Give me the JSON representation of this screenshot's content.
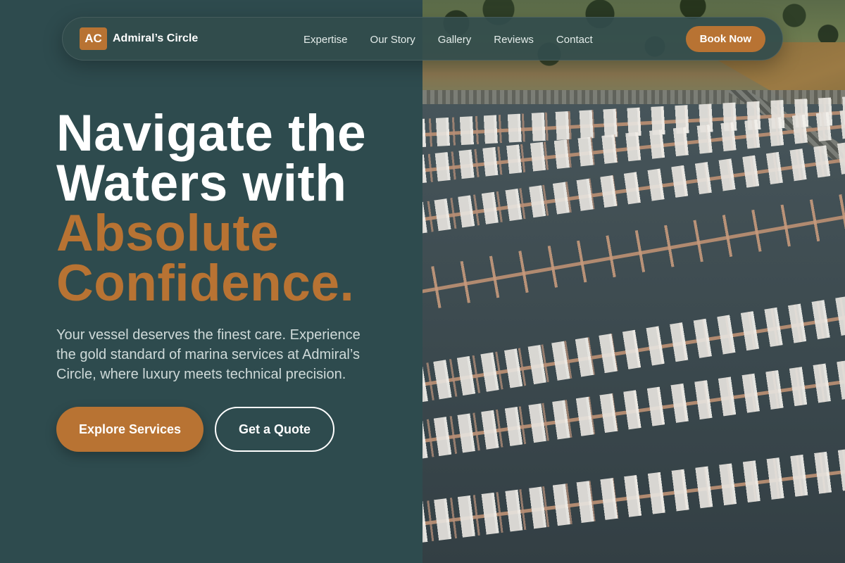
{
  "brand": {
    "badge": "AC",
    "name": "Admiral’s Circle"
  },
  "nav": {
    "links": [
      "Expertise",
      "Our Story",
      "Gallery",
      "Reviews",
      "Contact"
    ],
    "cta": "Book Now"
  },
  "hero": {
    "headline_white": [
      "Navigate the",
      "Waters with"
    ],
    "headline_accent": [
      "Absolute",
      "Confidence."
    ],
    "subtitle": "Your vessel deserves the finest care. Experience the gold standard of marina services at Admiral’s Circle, where luxury meets technical precision.",
    "primary_cta": "Explore Services",
    "secondary_cta": "Get a Quote"
  },
  "image": {
    "subject": "aerial-marina-photo"
  },
  "colors": {
    "background": "#2e4b4e",
    "accent": "#b87333",
    "text_light": "#ffffff",
    "text_muted": "#cfdad9"
  }
}
